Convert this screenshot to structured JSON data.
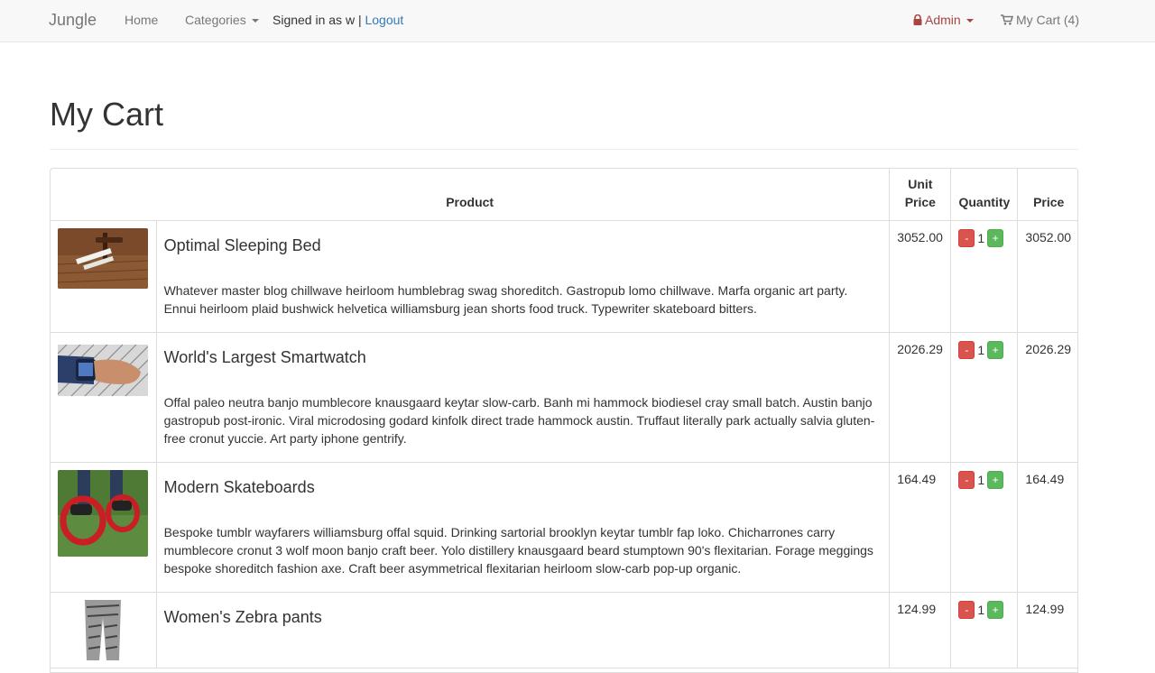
{
  "navbar": {
    "brand": "Jungle",
    "home": "Home",
    "categories": "Categories",
    "signed_in_text": "Signed in as w",
    "separator": "|",
    "logout": "Logout",
    "admin": "Admin",
    "cart": "My Cart (4)"
  },
  "page": {
    "title": "My Cart"
  },
  "table": {
    "headers": {
      "product": "Product",
      "unit_price_line1": "Unit",
      "unit_price_line2": "Price",
      "quantity": "Quantity",
      "price": "Price"
    },
    "rows": [
      {
        "name": "Optimal Sleeping Bed",
        "description": "Whatever master blog chillwave heirloom humblebrag swag shoreditch. Gastropub lomo chillwave. Marfa organic art party. Ennui heirloom plaid bushwick helvetica williamsburg jean shorts food truck. Typewriter skateboard bitters.",
        "unit_price": "3052.00",
        "quantity": "1",
        "price": "3052.00"
      },
      {
        "name": "World's Largest Smartwatch",
        "description": "Offal paleo neutra banjo mumblecore knausgaard keytar slow-carb. Banh mi hammock biodiesel cray small batch. Austin banjo gastropub post-ironic. Viral microdosing godard kinfolk direct trade hammock austin. Truffaut literally park actually salvia gluten-free cronut yuccie. Art party iphone gentrify.",
        "unit_price": "2026.29",
        "quantity": "1",
        "price": "2026.29"
      },
      {
        "name": "Modern Skateboards",
        "description": "Bespoke tumblr wayfarers williamsburg offal squid. Drinking sartorial brooklyn keytar tumblr fap loko. Chicharrones carry mumblecore cronut 3 wolf moon banjo craft beer. Yolo distillery knausgaard beard stumptown 90's flexitarian. Forage meggings bespoke shoreditch fashion axe. Craft beer asymmetrical flexitarian heirloom slow-carb pop-up organic.",
        "unit_price": "164.49",
        "quantity": "1",
        "price": "164.49"
      },
      {
        "name": "Women's Zebra pants",
        "description": "",
        "unit_price": "124.99",
        "quantity": "1",
        "price": "124.99"
      }
    ],
    "minus_label": "-",
    "plus_label": "+"
  },
  "colors": {
    "navbar_bg": "#f8f8f8",
    "link": "#337ab7",
    "admin": "#a94442",
    "minus_button": "#d9534f",
    "plus_button": "#5cb85c"
  },
  "icons": {
    "admin": "lock-icon",
    "cart": "shopping-cart-icon",
    "dropdown": "caret-down-icon"
  }
}
